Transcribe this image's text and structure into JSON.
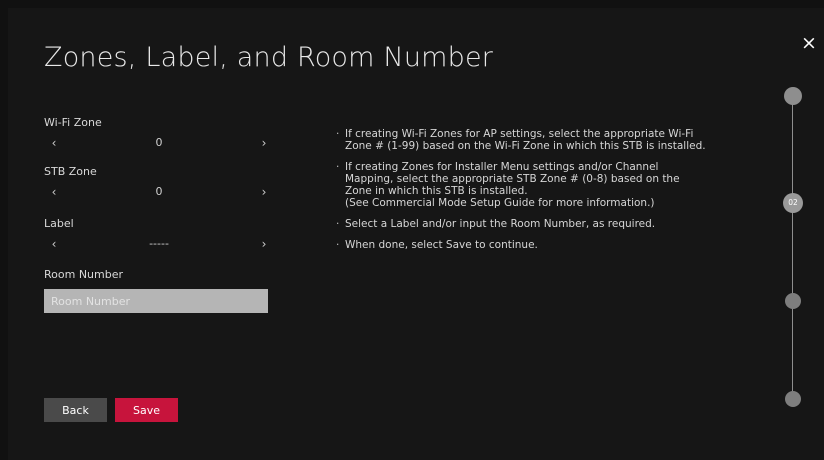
{
  "page": {
    "title": "Zones, Label, and Room Number",
    "close_icon": "×"
  },
  "fields": {
    "wifi_zone": {
      "label": "Wi-Fi Zone",
      "value": "0"
    },
    "stb_zone": {
      "label": "STB Zone",
      "value": "0"
    },
    "label": {
      "label": "Label",
      "value": "-----"
    },
    "room_number": {
      "label": "Room Number",
      "value": "",
      "placeholder": "Room Number"
    }
  },
  "arrows": {
    "left": "‹",
    "right": "›"
  },
  "buttons": {
    "back": "Back",
    "save": "Save"
  },
  "help": [
    "If creating Wi-Fi Zones for AP settings, select the appropriate Wi-Fi\nZone # (1-99) based on the Wi-Fi Zone in which this STB is installed.",
    "If creating Zones for Installer Menu settings and/or Channel\nMapping, select the appropriate STB Zone # (0-8) based on the\nZone in which this STB is installed.\n(See Commercial Mode Setup Guide for more information.)",
    "Select a Label and/or input the Room Number, as required.",
    "When done, select Save to continue."
  ],
  "progress": {
    "current_step_label": "02"
  },
  "colors": {
    "background": "#161616",
    "accent_save": "#c7143c",
    "back_button": "#4a4a4a",
    "input_bg": "#b5b5b5",
    "progress": "#8e8e8e"
  }
}
